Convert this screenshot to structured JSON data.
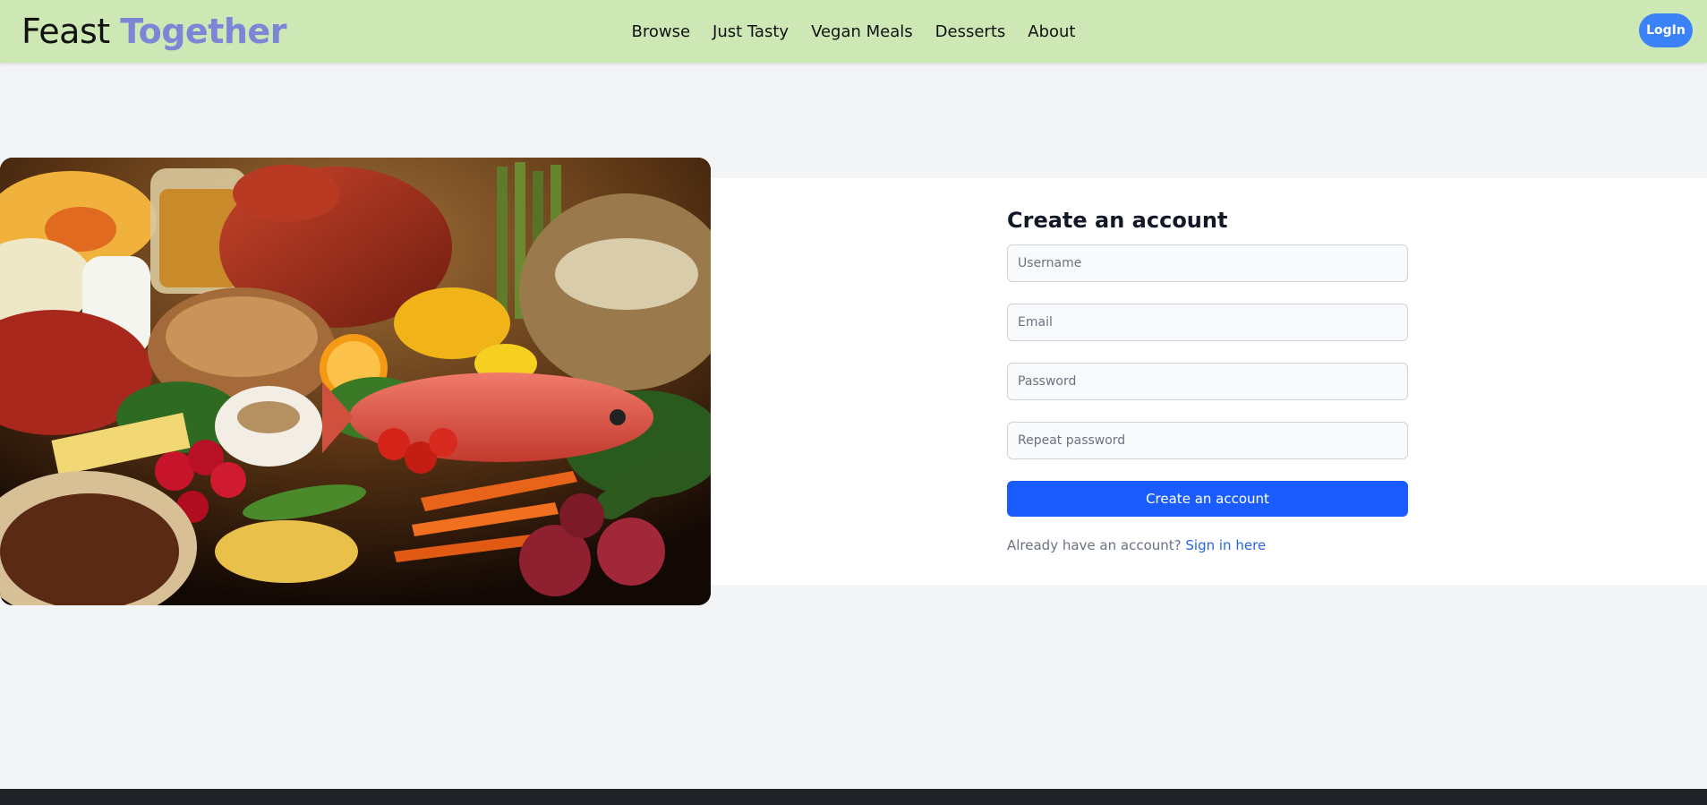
{
  "header": {
    "brand_part1": "Feast",
    "brand_part2": "Together",
    "nav": [
      "Browse",
      "Just Tasty",
      "Vegan Meals",
      "Desserts",
      "About"
    ],
    "login_label": "LogIn"
  },
  "hero": {
    "image_subject": "assorted groceries: bread, fish, carrots, radishes, meats, beans, pasta jar, asparagus"
  },
  "form": {
    "title": "Create an account",
    "username_placeholder": "Username",
    "email_placeholder": "Email",
    "password_placeholder": "Password",
    "repeat_password_placeholder": "Repeat password",
    "submit_label": "Create an account",
    "signin_prompt": "Already have an account?",
    "signin_link": "Sign in here"
  },
  "colors": {
    "header_bg": "#cde8b5",
    "brand_accent": "#7b86d6",
    "primary": "#1a5cff",
    "login_button": "#3b82f6",
    "page_bg": "#f3f4f6",
    "footer_bg": "#1f2328"
  }
}
